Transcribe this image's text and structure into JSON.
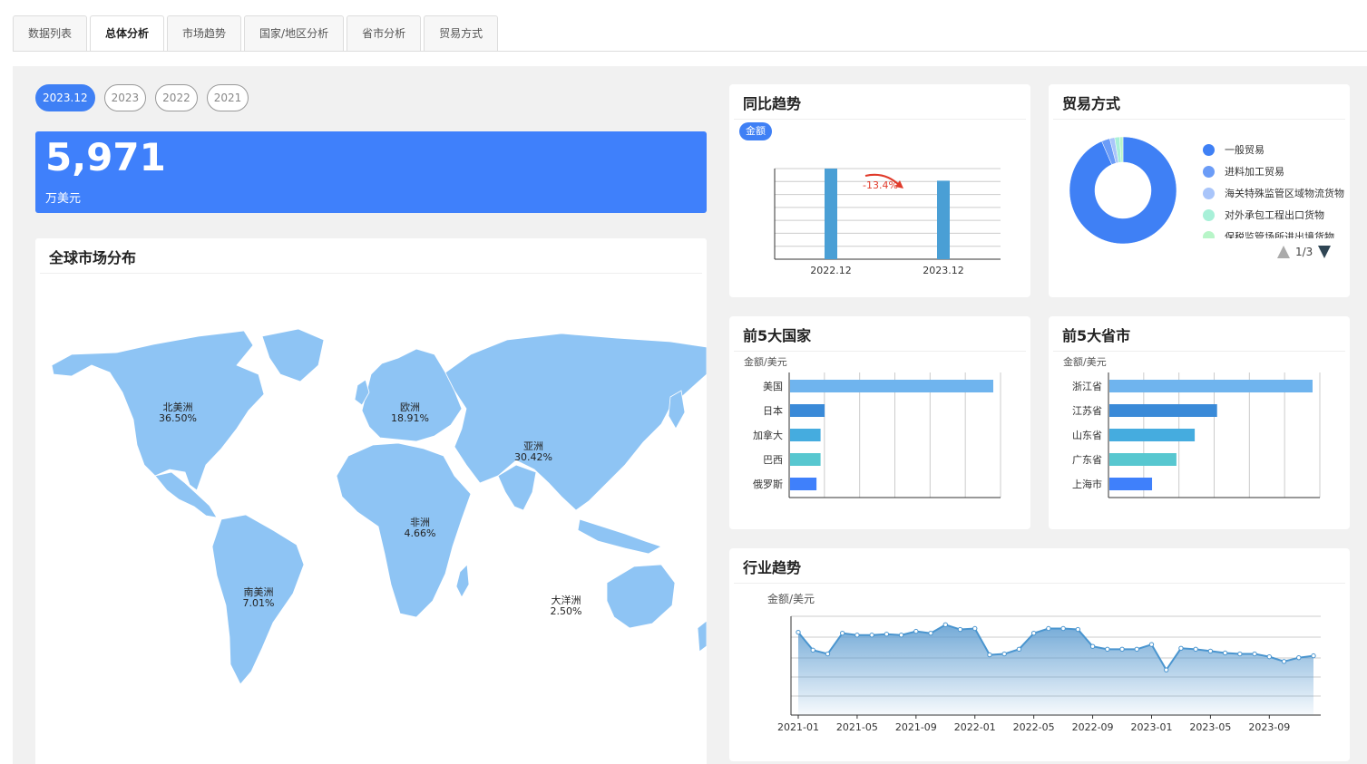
{
  "tabs": [
    "数据列表",
    "总体分析",
    "市场趋势",
    "国家/地区分析",
    "省市分析",
    "贸易方式"
  ],
  "active_tab": "总体分析",
  "years": [
    "2023.12",
    "2023",
    "2022",
    "2021"
  ],
  "active_year": "2023.12",
  "total": {
    "value": "5,971",
    "unit": "万美元"
  },
  "map": {
    "title": "全球市场分布",
    "regions": [
      {
        "name": "北美洲",
        "pct": "36.50%"
      },
      {
        "name": "欧洲",
        "pct": "18.91%"
      },
      {
        "name": "亚洲",
        "pct": "30.42%"
      },
      {
        "name": "非洲",
        "pct": "4.66%"
      },
      {
        "name": "南美洲",
        "pct": "7.01%"
      },
      {
        "name": "大洋洲",
        "pct": "2.50%"
      }
    ],
    "land_color": "#8ec4f4"
  },
  "yoy": {
    "title": "同比趋势",
    "badge": "金额",
    "change_label": "-13.4%",
    "chart_data": {
      "type": "bar",
      "categories": [
        "2022.12",
        "2023.12"
      ],
      "values": [
        100,
        86.6
      ],
      "color": "#4a9fd5"
    }
  },
  "trade": {
    "title": "贸易方式",
    "legend": [
      {
        "name": "一般贸易",
        "color": "#3f80f5"
      },
      {
        "name": "进料加工贸易",
        "color": "#6b9cf7"
      },
      {
        "name": "海关特殊监管区域物流货物",
        "color": "#a9c5fa"
      },
      {
        "name": "对外承包工程出口货物",
        "color": "#a8f0d8"
      },
      {
        "name": "保税监管场所进出境货物",
        "color": "#b8f5c8"
      }
    ],
    "pager": "1/3",
    "chart_data": {
      "type": "pie",
      "labels": [
        "一般贸易",
        "进料加工贸易",
        "海关特殊监管区域物流货物",
        "对外承包工程出口货物",
        "保税监管场所进出境货物"
      ],
      "values": [
        93.5,
        2.5,
        1.5,
        1.5,
        1.0
      ]
    }
  },
  "countries": {
    "title": "前5大国家",
    "unit": "金额/美元",
    "chart_data": {
      "type": "bar",
      "categories": [
        "美国",
        "日本",
        "加拿大",
        "巴西",
        "俄罗斯"
      ],
      "values": [
        100,
        17,
        15,
        15,
        13
      ]
    }
  },
  "provinces": {
    "title": "前5大省市",
    "unit": "金额/美元",
    "chart_data": {
      "type": "bar",
      "categories": [
        "浙江省",
        "江苏省",
        "山东省",
        "广东省",
        "上海市"
      ],
      "values": [
        100,
        53,
        42,
        33,
        21
      ]
    }
  },
  "industry": {
    "title": "行业趋势",
    "unit": "金额/美元",
    "chart_data": {
      "type": "area",
      "x_ticks": [
        "2021-01",
        "2021-05",
        "2021-09",
        "2022-01",
        "2022-05",
        "2022-09",
        "2023-01",
        "2023-05",
        "2023-09"
      ],
      "values": [
        88,
        69,
        65,
        87,
        85,
        85,
        86,
        85,
        89,
        87,
        96,
        91,
        92,
        64,
        65,
        70,
        87,
        92,
        92,
        91,
        73,
        70,
        70,
        70,
        75,
        48,
        71,
        70,
        68,
        66,
        65,
        65,
        62,
        57,
        61,
        63
      ]
    }
  }
}
